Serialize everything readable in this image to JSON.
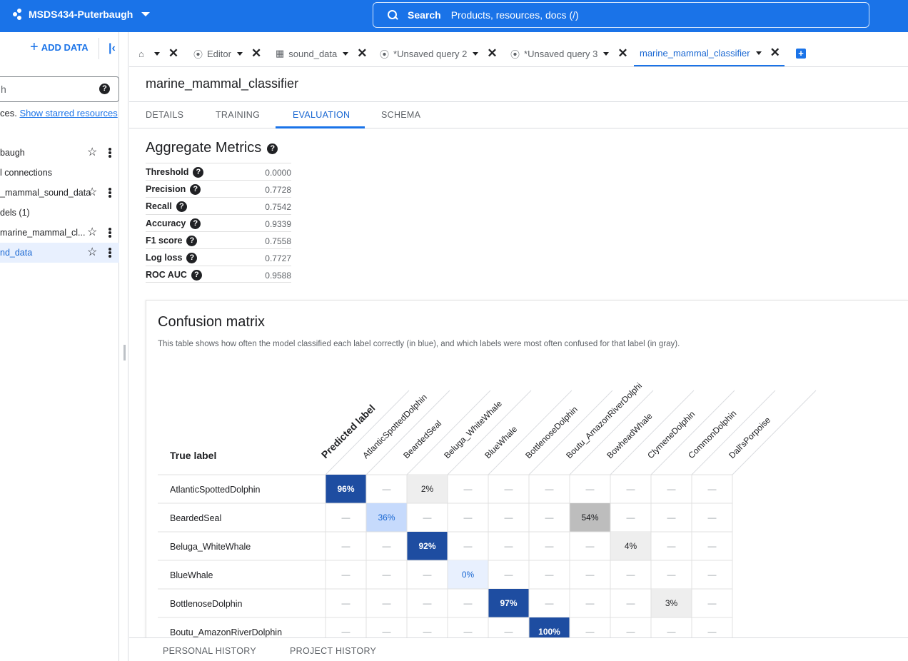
{
  "header": {
    "project_name": "MSDS434-Puterbaugh",
    "search_label": "Search",
    "search_placeholder": "Products, resources, docs (/)"
  },
  "sidebar": {
    "add_data_label": "ADD DATA",
    "search_partial": "h",
    "starred_prefix": "ces.",
    "starred_link": "Show starred resources",
    "items": [
      {
        "label": "baugh",
        "star": true,
        "menu": true,
        "selected": false
      },
      {
        "label": "l connections",
        "star": false,
        "menu": false,
        "selected": false
      },
      {
        "label": "_mammal_sound_data",
        "star": true,
        "menu": true,
        "selected": false
      },
      {
        "label": "dels (1)",
        "star": false,
        "menu": false,
        "selected": false
      },
      {
        "label": "marine_mammal_cl...",
        "star": true,
        "menu": true,
        "selected": false
      },
      {
        "label": "nd_data",
        "star": true,
        "menu": true,
        "selected": true
      }
    ]
  },
  "tabs": [
    {
      "label": "",
      "icon": "home-icon"
    },
    {
      "label": "Editor",
      "icon": "query-icon"
    },
    {
      "label": "sound_data",
      "icon": "table-icon"
    },
    {
      "label": "*Unsaved query 2",
      "icon": "query-icon"
    },
    {
      "label": "*Unsaved query 3",
      "icon": "query-icon"
    },
    {
      "label": "marine_mammal_classifier",
      "icon": "",
      "active": true
    }
  ],
  "model": {
    "title": "marine_mammal_classifier",
    "subtabs": [
      "DETAILS",
      "TRAINING",
      "EVALUATION",
      "SCHEMA"
    ],
    "active_subtab": "EVALUATION"
  },
  "aggregate": {
    "title": "Aggregate Metrics",
    "metrics": [
      {
        "name": "Threshold",
        "value": "0.0000"
      },
      {
        "name": "Precision",
        "value": "0.7728"
      },
      {
        "name": "Recall",
        "value": "0.7542"
      },
      {
        "name": "Accuracy",
        "value": "0.9339"
      },
      {
        "name": "F1 score",
        "value": "0.7558"
      },
      {
        "name": "Log loss",
        "value": "0.7727"
      },
      {
        "name": "ROC AUC",
        "value": "0.9588"
      }
    ]
  },
  "confusion": {
    "title": "Confusion matrix",
    "description": "This table shows how often the model classified each label correctly (in blue), and which labels were most often confused for that label (in gray).",
    "predicted_header": "Predicted label",
    "true_header": "True label",
    "columns": [
      "AtlanticSpottedDolphin",
      "BeardedSeal",
      "Beluga_WhiteWhale",
      "BlueWhale",
      "BottlenoseDolphin",
      "Boutu_AmazonRiverDolphi",
      "BowheadWhale",
      "ClymeneDolphin",
      "CommonDolphin",
      "Dall'sPorpoise"
    ],
    "rows": [
      {
        "label": "AtlanticSpottedDolphin",
        "cells": [
          "96%",
          "—",
          "2%",
          "—",
          "—",
          "—",
          "—",
          "—",
          "—",
          "—"
        ]
      },
      {
        "label": "BeardedSeal",
        "cells": [
          "—",
          "36%",
          "—",
          "—",
          "—",
          "—",
          "54%",
          "—",
          "—",
          "—"
        ]
      },
      {
        "label": "Beluga_WhiteWhale",
        "cells": [
          "—",
          "—",
          "92%",
          "—",
          "—",
          "—",
          "—",
          "4%",
          "—",
          "—"
        ]
      },
      {
        "label": "BlueWhale",
        "cells": [
          "—",
          "—",
          "—",
          "0%",
          "—",
          "—",
          "—",
          "—",
          "—",
          "—"
        ]
      },
      {
        "label": "BottlenoseDolphin",
        "cells": [
          "—",
          "—",
          "—",
          "—",
          "97%",
          "—",
          "—",
          "—",
          "3%",
          "—"
        ]
      },
      {
        "label": "Boutu_AmazonRiverDolphin",
        "cells": [
          "—",
          "—",
          "—",
          "—",
          "—",
          "100%",
          "—",
          "—",
          "—",
          "—"
        ]
      }
    ],
    "colors": {
      "diag_strong": "#1e4da1",
      "diag_light": "#c6dafc",
      "diag_faint": "#e8f0fe",
      "off_mid": "#bdbdbd",
      "off_light": "#eeeeee"
    }
  },
  "bottom": {
    "tabs": [
      "PERSONAL HISTORY",
      "PROJECT HISTORY"
    ]
  }
}
